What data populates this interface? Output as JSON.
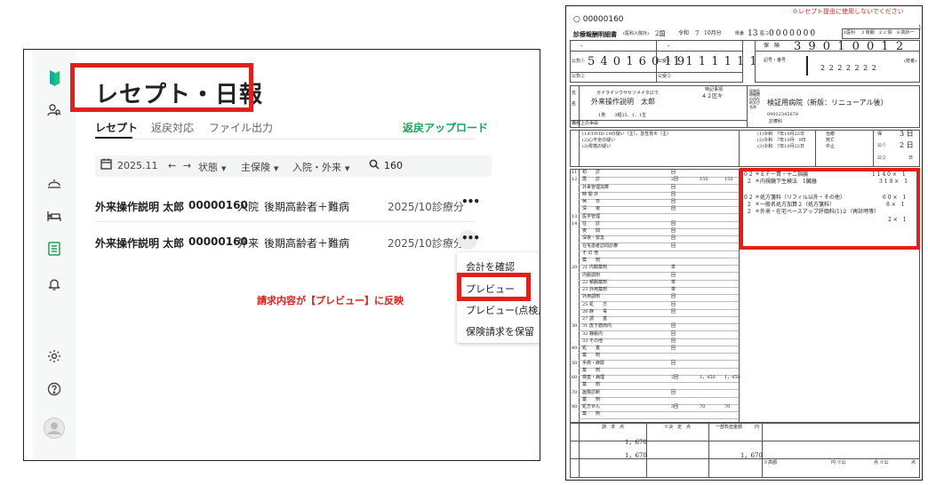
{
  "app": {
    "page_title": "レセプト・日報",
    "tabs": [
      {
        "label": "レセプト",
        "active": true
      },
      {
        "label": "返戻対応",
        "active": false
      },
      {
        "label": "ファイル出力",
        "active": false
      }
    ],
    "upload_link": "返戻アップロード",
    "filters": {
      "month": "2025.11",
      "status": "状態",
      "insurance": "主保険",
      "care_type": "入院・外来",
      "search": "160"
    },
    "rows": [
      {
        "name": "外来操作説明 太郎",
        "id": "00000160",
        "type": "入院",
        "insurance": "後期高齢者＋難病",
        "period": "2025/10診療分"
      },
      {
        "name": "外来操作説明 太郎",
        "id": "00000160",
        "type": "外来",
        "insurance": "後期高齢者＋難病",
        "period": "2025/10診療分"
      }
    ],
    "menu": [
      "会計を確認",
      "プレビュー",
      "プレビュー(点検用)",
      "保険請求を保留"
    ],
    "annotation": "請求内容が【プレビュー】に反映",
    "colors": {
      "accent_red": "#e0201b",
      "brand_green": "#1aa35b"
    },
    "icons": [
      "logo-icon",
      "user-search-icon",
      "reception-icon",
      "bed-icon",
      "receipt-icon",
      "bell-icon",
      "settings-icon",
      "help-icon",
      "avatar-icon"
    ]
  },
  "receipt": {
    "warning": "※レセプト提出に使用しないでください",
    "patient_no": "00000160",
    "form_title": "診療報酬明細書",
    "form_sub": "(医科入院外)",
    "page": "2国",
    "era": "令和",
    "year": "7",
    "month": "10月分",
    "pref_label": "県番",
    "pref_no": "13",
    "med_code_label": "医コ",
    "med_code": "0000000",
    "flags": [
      "1医科",
      "3 後期",
      "2 2 併",
      "8 高外一"
    ],
    "insurer_label": "保　険",
    "insurer_no": "3 9 0 1 0 0 1 2",
    "kohi1_label": "公負①",
    "kohi1_no": "5 4 0 1 6 0 1 9",
    "kohi1_recipient_label": "公受①",
    "kohi1_recipient_no": "1 1 1 1 1 1 1",
    "kohi2_label": "公負②",
    "kohi2_recipient_label": "公受②",
    "symbol_label": "記号・番号",
    "symbol_no": "2 2 2 2 2 2 2",
    "branch_label": "(枝番)",
    "kana_name": "ガイライソウサセツメイタロウ",
    "patient_name": "外来操作説明　太郎",
    "special_label": "特記事項",
    "special_value": "４２区キ",
    "institution_label": "保険医療機関の所在地及び名称",
    "institution_name": "検証用病院（新版：リニューアル後）",
    "institution_tel": "09012345678",
    "dept": "診療科",
    "birth": "1男　　3昭25．1．1生",
    "disease_type": "職務上の事由",
    "diagnoses": [
      "(1)COVID-19の疑い（主），急性胃炎（主）",
      "(2)心不全の疑い",
      "(3)胃癌の疑い"
    ],
    "start_dates": [
      "(1)令和　7年10月22日",
      "(2)令和　7年10月　9日",
      "(3)令和　7年10月22日"
    ],
    "outcomes": [
      "治癒",
      "死亡",
      "中止"
    ],
    "days": [
      {
        "label": "保",
        "value": "3 日"
      },
      {
        "label": "公①",
        "value": "2 日"
      },
      {
        "label": "公②",
        "value": "日"
      }
    ],
    "left_items": [
      {
        "code": "11",
        "label": "初　　診",
        "count": "回",
        "points": "",
        "total": ""
      },
      {
        "code": "12",
        "label": "再　　診",
        "count": "2回",
        "points": "150",
        "total": "150"
      },
      {
        "code": "",
        "label": "外来管理加算",
        "count": "回",
        "points": "",
        "total": ""
      },
      {
        "code": "",
        "label": "時 間 外",
        "count": "回",
        "points": "",
        "total": ""
      },
      {
        "code": "",
        "label": "休　　日",
        "count": "回",
        "points": "",
        "total": ""
      },
      {
        "code": "",
        "label": "深　　夜",
        "count": "回",
        "points": "",
        "total": ""
      },
      {
        "code": "13",
        "label": "医学管理",
        "count": "",
        "points": "",
        "total": ""
      },
      {
        "code": "14",
        "label": "往　　診",
        "count": "回",
        "points": "",
        "total": ""
      },
      {
        "code": "",
        "label": "夜　　間",
        "count": "回",
        "points": "",
        "total": ""
      },
      {
        "code": "",
        "label": "深夜・緊急",
        "count": "回",
        "points": "",
        "total": ""
      },
      {
        "code": "",
        "label": "在宅患者訪問診療",
        "count": "回",
        "points": "",
        "total": ""
      },
      {
        "code": "",
        "label": "そ の 他",
        "count": "",
        "points": "",
        "total": ""
      },
      {
        "code": "",
        "label": "薬　　剤",
        "count": "",
        "points": "",
        "total": ""
      },
      {
        "code": "20",
        "label": "21 内服薬剤",
        "count": "単",
        "points": "",
        "total": ""
      },
      {
        "code": "",
        "label": "内服調剤",
        "count": "回",
        "points": "",
        "total": ""
      },
      {
        "code": "",
        "label": "22 頓服薬剤",
        "count": "単",
        "points": "",
        "total": ""
      },
      {
        "code": "",
        "label": "23 外用薬剤",
        "count": "単",
        "points": "",
        "total": ""
      },
      {
        "code": "",
        "label": "外用調剤",
        "count": "回",
        "points": "",
        "total": ""
      },
      {
        "code": "",
        "label": "25 処　　方",
        "count": "回",
        "points": "",
        "total": ""
      },
      {
        "code": "",
        "label": "26 麻　　毒",
        "count": "回",
        "points": "",
        "total": ""
      },
      {
        "code": "",
        "label": "27 調　　基",
        "count": "",
        "points": "",
        "total": ""
      },
      {
        "code": "30",
        "label": "31 皮下筋肉内",
        "count": "回",
        "points": "",
        "total": ""
      },
      {
        "code": "",
        "label": "32 静脈内",
        "count": "回",
        "points": "",
        "total": ""
      },
      {
        "code": "",
        "label": "33 その他",
        "count": "回",
        "points": "",
        "total": ""
      },
      {
        "code": "40",
        "label": "処　　置",
        "count": "回",
        "points": "",
        "total": ""
      },
      {
        "code": "",
        "label": "薬　　剤",
        "count": "",
        "points": "",
        "total": ""
      },
      {
        "code": "50",
        "label": "手術・麻酔",
        "count": "回",
        "points": "",
        "total": ""
      },
      {
        "code": "",
        "label": "薬　　剤",
        "count": "",
        "points": "",
        "total": ""
      },
      {
        "code": "60",
        "label": "検査・病理",
        "count": "2回",
        "points": "1，450",
        "total": "1，450"
      },
      {
        "code": "",
        "label": "薬　　剤",
        "count": "",
        "points": "",
        "total": ""
      },
      {
        "code": "70",
        "label": "画像診断",
        "count": "回",
        "points": "",
        "total": ""
      },
      {
        "code": "",
        "label": "薬　　剤",
        "count": "",
        "points": "",
        "total": ""
      },
      {
        "code": "80",
        "label": "処方せん",
        "count": "3回",
        "points": "70",
        "total": "70"
      },
      {
        "code": "",
        "label": "薬　　剤",
        "count": "",
        "points": "",
        "total": ""
      }
    ],
    "detail_lines": [
      {
        "code": "0 2",
        "text": "＊ＥＦ－胃・十二指腸",
        "qty": "1 1 4 0 ×　1"
      },
      {
        "code": "2",
        "text": "＊内視鏡下生検法　1臓器",
        "qty": "3 1 0 ×　1"
      },
      {
        "code": "0 2",
        "text": "＊処方箋料（リフィル以外・その他）",
        "qty": "6 0 ×　1"
      },
      {
        "code": "2",
        "text": "＊一般名処方加算２（処方箋料）",
        "qty": "8 ×　1"
      },
      {
        "code": "2",
        "text": "＊外来・在宅ベースアップ評価料(1)２（再診時等）",
        "qty": ""
      },
      {
        "code": "",
        "text": "",
        "qty": "2 ×　1"
      }
    ],
    "footer": {
      "claim_label": "請　求　点",
      "decision_label": "※決　定　点",
      "burden_label": "一部負担金額",
      "yen": "円",
      "insurance_points": "1，670",
      "kohi1_points": "1，670",
      "kohi1_burden": "1，670",
      "high_cost": "※高額",
      "meal_labels": [
        "円 ※公",
        "点 ※公",
        "点"
      ]
    }
  }
}
